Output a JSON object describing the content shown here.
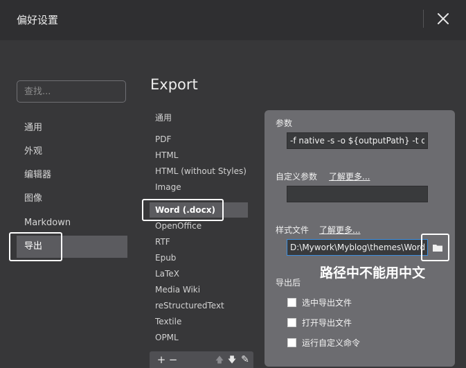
{
  "window": {
    "title": "偏好设置"
  },
  "search": {
    "placeholder": "查找..."
  },
  "sidebar": {
    "items": [
      {
        "label": "通用",
        "active": false
      },
      {
        "label": "外观",
        "active": false
      },
      {
        "label": "编辑器",
        "active": false
      },
      {
        "label": "图像",
        "active": false
      },
      {
        "label": "Markdown",
        "active": false
      },
      {
        "label": "导出",
        "active": true
      }
    ]
  },
  "export": {
    "title": "Export",
    "formats": [
      {
        "label": "通用",
        "active": false
      },
      {
        "label": "PDF",
        "active": false
      },
      {
        "label": "HTML",
        "active": false
      },
      {
        "label": "HTML (without Styles)",
        "active": false
      },
      {
        "label": "Image",
        "active": false
      },
      {
        "label": "Word (.docx)",
        "active": true
      },
      {
        "label": "OpenOffice",
        "active": false
      },
      {
        "label": "RTF",
        "active": false
      },
      {
        "label": "Epub",
        "active": false
      },
      {
        "label": "LaTeX",
        "active": false
      },
      {
        "label": "Media Wiki",
        "active": false
      },
      {
        "label": "reStructuredText",
        "active": false
      },
      {
        "label": "Textile",
        "active": false
      },
      {
        "label": "OPML",
        "active": false
      }
    ],
    "toolbar": {
      "add": "+",
      "remove": "−",
      "up": "🡅",
      "down": "🡇",
      "edit": "✎"
    }
  },
  "panel": {
    "params_label": "参数",
    "params_value": "-f native -s -o ${outputPath} -t docx",
    "custom_params_label": "自定义参数",
    "custom_params_link": "了解更多...",
    "custom_params_value": "",
    "style_file_label": "样式文件",
    "style_file_link": "了解更多...",
    "style_file_value": "D:\\Mywork\\Myblog\\themes\\Word.docx",
    "after_export_label": "导出后",
    "options": [
      {
        "label": "选中导出文件",
        "checked": false
      },
      {
        "label": "打开导出文件",
        "checked": false
      },
      {
        "label": "运行自定义命令",
        "checked": false
      }
    ]
  },
  "annotation": {
    "note": "路径中不能用中文"
  },
  "colors": {
    "accent": "#3d8fe0",
    "panel_bg": "#6c6c70",
    "highlight": "#ffffff"
  }
}
